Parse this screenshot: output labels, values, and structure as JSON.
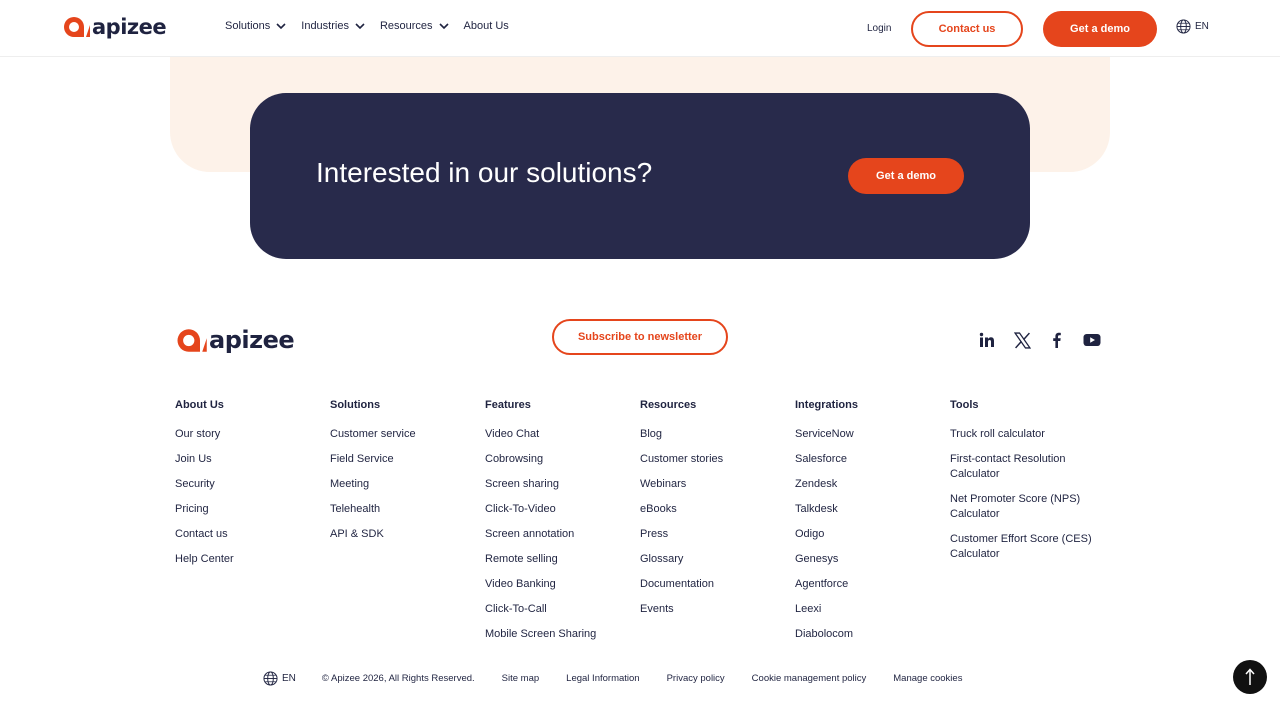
{
  "brand": {
    "name": "apizee",
    "accent": "#e5451c",
    "navy": "#282a4b",
    "peach": "#fdf2e9"
  },
  "header": {
    "nav": [
      {
        "label": "Solutions",
        "has_dropdown": true
      },
      {
        "label": "Industries",
        "has_dropdown": true
      },
      {
        "label": "Resources",
        "has_dropdown": true
      },
      {
        "label": "About Us",
        "has_dropdown": false
      }
    ],
    "login": "Login",
    "contact": "Contact us",
    "demo": "Get a demo",
    "lang": "EN"
  },
  "cta": {
    "title": "Interested in our solutions?",
    "button": "Get a demo"
  },
  "footer": {
    "newsletter": "Subscribe to newsletter",
    "socials": [
      "linkedin-icon",
      "x-icon",
      "facebook-icon",
      "youtube-icon"
    ],
    "columns": [
      {
        "title": "About Us",
        "links": [
          "Our story",
          "Join Us",
          "Security",
          "Pricing",
          "Contact us",
          "Help Center"
        ]
      },
      {
        "title": "Solutions",
        "links": [
          "Customer service",
          "Field Service",
          "Meeting",
          "Telehealth",
          "API & SDK"
        ]
      },
      {
        "title": "Features",
        "links": [
          "Video Chat",
          "Cobrowsing",
          "Screen sharing",
          "Click-To-Video",
          "Screen annotation",
          "Remote selling",
          "Video Banking",
          "Click-To-Call",
          "Mobile Screen Sharing"
        ]
      },
      {
        "title": "Resources",
        "links": [
          "Blog",
          "Customer stories",
          "Webinars",
          "eBooks",
          "Press",
          "Glossary",
          "Documentation",
          "Events"
        ]
      },
      {
        "title": "Integrations",
        "links": [
          "ServiceNow",
          "Salesforce",
          "Zendesk",
          "Talkdesk",
          "Odigo",
          "Genesys",
          "Agentforce",
          "Leexi",
          "Diabolocom"
        ]
      },
      {
        "title": "Tools",
        "links": [
          "Truck roll calculator",
          "First-contact Resolution Calculator",
          "Net Promoter Score (NPS) Calculator",
          "Customer Effort Score (CES) Calculator"
        ]
      }
    ],
    "bottom": {
      "lang": "EN",
      "copyright": "© Apizee 2026, All Rights Reserved.",
      "links": [
        "Site map",
        "Legal Information",
        "Privacy policy",
        "Cookie management policy",
        "Manage cookies"
      ]
    }
  }
}
